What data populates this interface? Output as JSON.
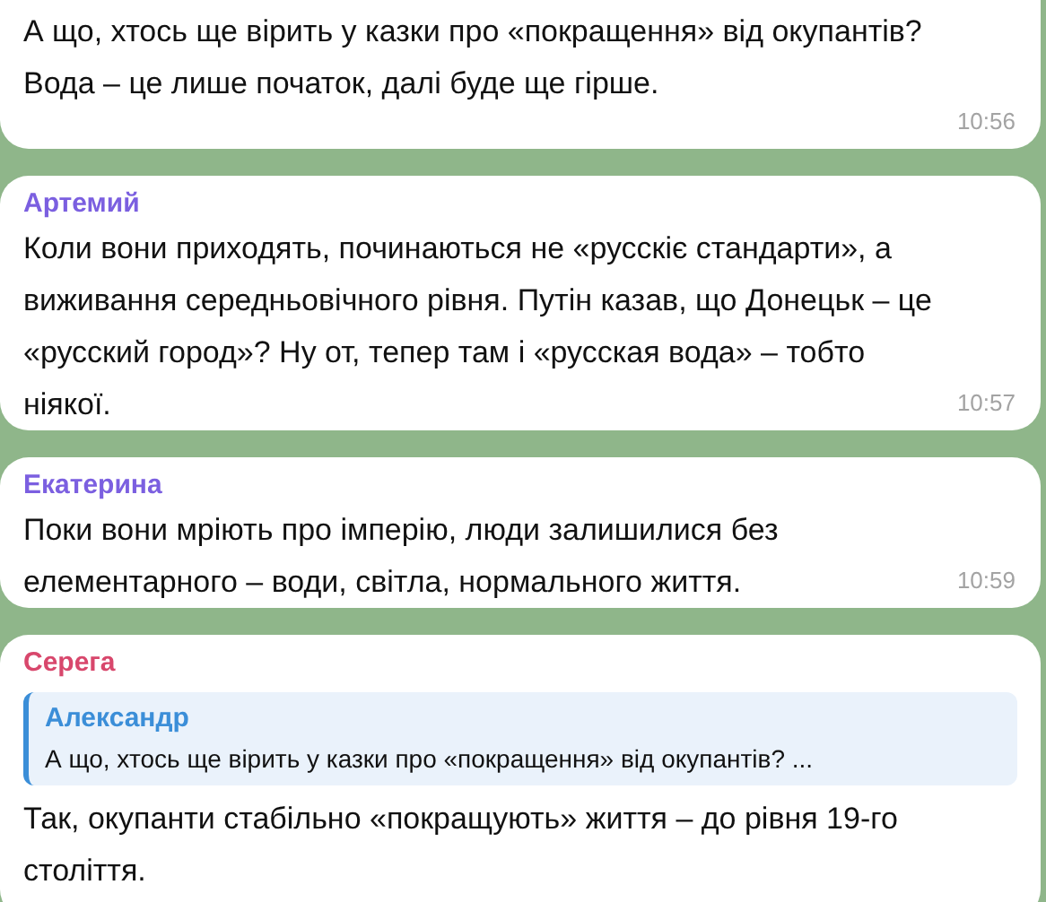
{
  "messages": [
    {
      "text": "А що, хтось ще вірить у казки про «покращення» від окупантів? Вода – це лише початок, далі буде ще гірше.",
      "time": "10:56"
    },
    {
      "sender": "Артемий",
      "color": "#7b5fe0",
      "text": "Коли вони приходять, починаються не «русскіє стандарти», а виживання середньовічного рівня. Путін казав, що Донецьк – це «русский город»? Ну от, тепер там і «русская вода» – тобто ніякої.",
      "time": "10:57"
    },
    {
      "sender": "Екатерина",
      "color": "#7b5fe0",
      "text": "Поки вони мріють про імперію, люди залишилися без елементарного – води, світла, нормального життя.",
      "time": "10:59"
    },
    {
      "sender": "Серега",
      "color": "#d8476c",
      "reply": {
        "sender": "Александр",
        "color": "#3b8ed8",
        "text": "А що, хтось ще вірить у казки про «покращення» від окупантів? ..."
      },
      "text": "Так, окупанти стабільно «покращують» життя – до рівня 19-го століття."
    }
  ]
}
